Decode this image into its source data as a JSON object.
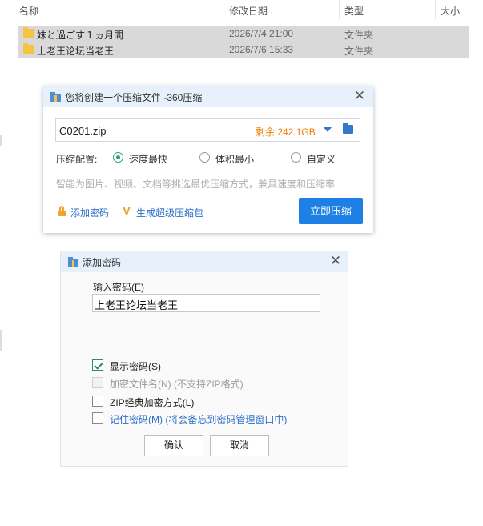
{
  "explorer": {
    "columns": [
      "名称",
      "修改日期",
      "类型",
      "大小"
    ],
    "files": [
      {
        "name": "妹と過ごす１ヵ月間",
        "date": "2026/7/4 21:00",
        "type": "文件夹"
      },
      {
        "name": "上老王论坛当老王",
        "date": "2026/7/6 15:33",
        "type": "文件夹"
      }
    ]
  },
  "compress_dialog": {
    "title": "您将创建一个压缩文件 -360压缩",
    "filename": "C0201.zip",
    "space_left": "剩余:242.1GB",
    "config_label": "压缩配置:",
    "options": [
      {
        "label": "速度最快",
        "selected": true
      },
      {
        "label": "体积最小",
        "selected": false
      },
      {
        "label": "自定义",
        "selected": false
      }
    ],
    "description": "智能为图片、视频、文档等挑选最优压缩方式，兼具速度和压缩率",
    "add_password_link": "添加密码",
    "super_package_link": "生成超级压缩包",
    "compress_button": "立即压缩",
    "accent_color": "#1e7fe5"
  },
  "password_dialog": {
    "title": "添加密码",
    "input_label": "输入密码(E)",
    "password_value": "上老王论坛当老王",
    "checkboxes": [
      {
        "label": "显示密码(S)",
        "checked": true,
        "enabled": true
      },
      {
        "label": "加密文件名(N) (不支持ZIP格式)",
        "checked": false,
        "enabled": false
      },
      {
        "label": "ZIP经典加密方式(L)",
        "checked": false,
        "enabled": true
      },
      {
        "label": "记住密码(M) (将会备忘到密码管理窗口中)",
        "checked": false,
        "enabled": true
      }
    ],
    "ok_button": "确认",
    "cancel_button": "取消"
  }
}
